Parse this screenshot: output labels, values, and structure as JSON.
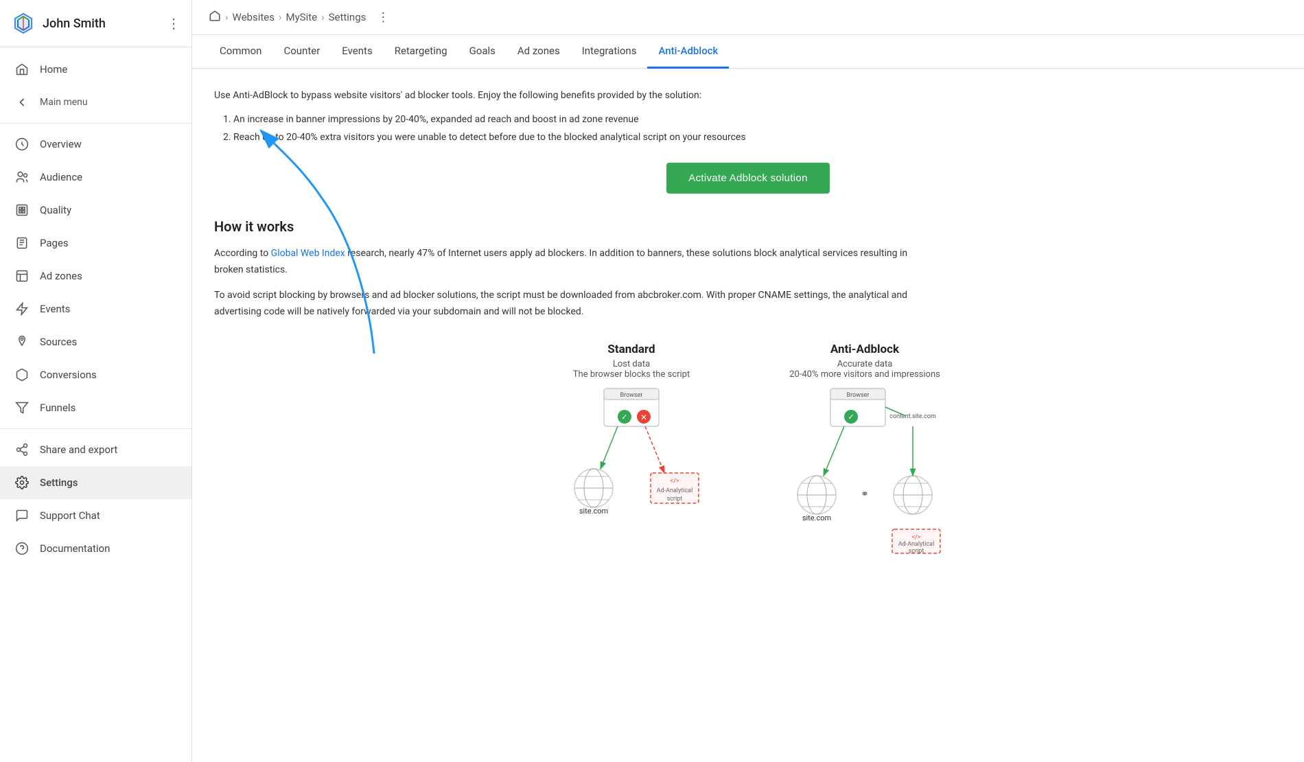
{
  "sidebar": {
    "user": {
      "name": "John Smith",
      "logo_alt": "brand-logo"
    },
    "main_menu_label": "Main menu",
    "nav_items": [
      {
        "id": "home",
        "label": "Home",
        "icon": "home"
      },
      {
        "id": "overview",
        "label": "Overview",
        "icon": "overview"
      },
      {
        "id": "audience",
        "label": "Audience",
        "icon": "audience"
      },
      {
        "id": "quality",
        "label": "Quality",
        "icon": "quality"
      },
      {
        "id": "pages",
        "label": "Pages",
        "icon": "pages"
      },
      {
        "id": "adzones",
        "label": "Ad zones",
        "icon": "adzones"
      },
      {
        "id": "events",
        "label": "Events",
        "icon": "events"
      },
      {
        "id": "sources",
        "label": "Sources",
        "icon": "sources"
      },
      {
        "id": "conversions",
        "label": "Conversions",
        "icon": "conversions"
      },
      {
        "id": "funnels",
        "label": "Funnels",
        "icon": "funnels"
      }
    ],
    "bottom_items": [
      {
        "id": "share",
        "label": "Share and export",
        "icon": "share"
      },
      {
        "id": "settings",
        "label": "Settings",
        "icon": "settings",
        "active": true
      },
      {
        "id": "support",
        "label": "Support Chat",
        "icon": "support"
      },
      {
        "id": "docs",
        "label": "Documentation",
        "icon": "docs"
      }
    ]
  },
  "breadcrumb": {
    "home_icon": "home",
    "items": [
      "Websites",
      "MySite",
      "Settings"
    ],
    "more_icon": "more-vertical"
  },
  "tabs": [
    {
      "id": "common",
      "label": "Common"
    },
    {
      "id": "counter",
      "label": "Counter"
    },
    {
      "id": "events",
      "label": "Events"
    },
    {
      "id": "retargeting",
      "label": "Retargeting"
    },
    {
      "id": "goals",
      "label": "Goals"
    },
    {
      "id": "adzones",
      "label": "Ad zones"
    },
    {
      "id": "integrations",
      "label": "Integrations"
    },
    {
      "id": "antiadblock",
      "label": "Anti-Adblock",
      "active": true
    }
  ],
  "content": {
    "intro": "Use Anti-AdBlock to bypass website visitors' ad blocker tools. Enjoy the following benefits provided by the solution:",
    "benefits": [
      "An increase in banner impressions by 20-40%, expanded ad reach and boost in ad zone revenue",
      "Reach up to 20-40% extra visitors you were unable to detect before due to the blocked analytical script on your resources"
    ],
    "activate_btn_label": "Activate Adblock solution",
    "how_it_works_title": "How it works",
    "how_it_works_p1_before": "According to ",
    "how_it_works_link": "Global Web Index",
    "how_it_works_p1_after": " research, nearly 47% of Internet users apply ad blockers. In addition to banners, these solutions block analytical services resulting in broken statistics.",
    "how_it_works_p2": "To avoid script blocking by browsers and ad blocker solutions, the script must be downloaded from abcbroker.com. With proper CNAME settings, the analytical and advertising code will be natively forwarded via your subdomain and will not be blocked.",
    "diagrams": [
      {
        "id": "standard",
        "title": "Standard",
        "subtitle_line1": "Lost data",
        "subtitle_line2": "The browser blocks the script",
        "nodes": {
          "browser_label": "Browser",
          "site_label": "site.com",
          "script_label": "Ad-Analytical\nscript"
        }
      },
      {
        "id": "antiadblock",
        "title": "Anti-Adblock",
        "subtitle_line1": "Accurate data",
        "subtitle_line2": "20-40% more visitors and impressions",
        "nodes": {
          "browser_label": "Browser",
          "content_site_label": "content.site.com",
          "site_label": "site.com",
          "script_label": "Ad-Analytical\nscript"
        }
      }
    ]
  }
}
